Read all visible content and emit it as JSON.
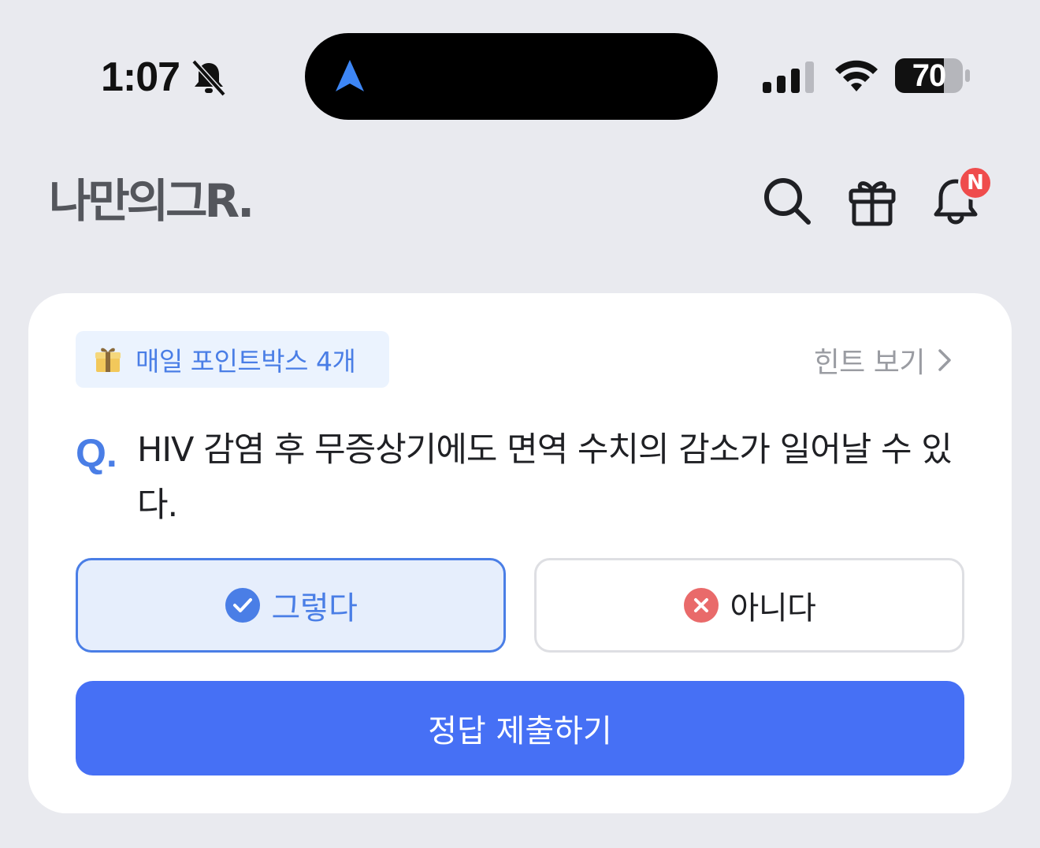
{
  "status_bar": {
    "time": "1:07",
    "battery": "70"
  },
  "header": {
    "logo": "나만의그R.",
    "notification_badge": "N"
  },
  "quiz": {
    "points_chip": "매일 포인트박스 4개",
    "hint_label": "힌트 보기",
    "question_mark": "Q.",
    "question_text": "HIV 감염 후 무증상기에도 면역 수치의 감소가 일어날 수 있다.",
    "choice_yes": "그렇다",
    "choice_no": "아니다",
    "submit_label": "정답 제출하기",
    "selected": "yes"
  },
  "colors": {
    "accent": "#4a7ee6",
    "submit": "#4670f5",
    "badge": "#ef4c4c",
    "no_icon": "#e96a6a",
    "background": "#e9eaef"
  }
}
